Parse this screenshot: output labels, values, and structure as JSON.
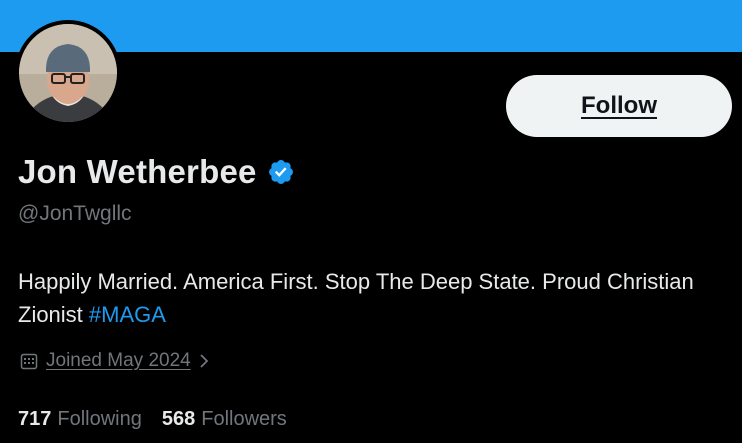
{
  "profile": {
    "display_name": "Jon Wetherbee",
    "handle": "@JonTwgllc",
    "bio_text": "Happily Married. America First. Stop The Deep State. Proud Christian Zionist ",
    "bio_hashtag": "#MAGA",
    "joined": "Joined May 2024",
    "following_count": "717",
    "following_label": "Following",
    "followers_count": "568",
    "followers_label": "Followers"
  },
  "actions": {
    "follow_label": "Follow"
  },
  "icons": {
    "verified": "verified-badge-icon",
    "calendar": "calendar-icon",
    "chevron": "chevron-right-icon"
  },
  "colors": {
    "banner": "#1d9bf0",
    "background": "#000000",
    "accent": "#1d9bf0",
    "text_primary": "#e7e9ea",
    "text_secondary": "#71767b",
    "button_bg": "#eff3f4"
  }
}
